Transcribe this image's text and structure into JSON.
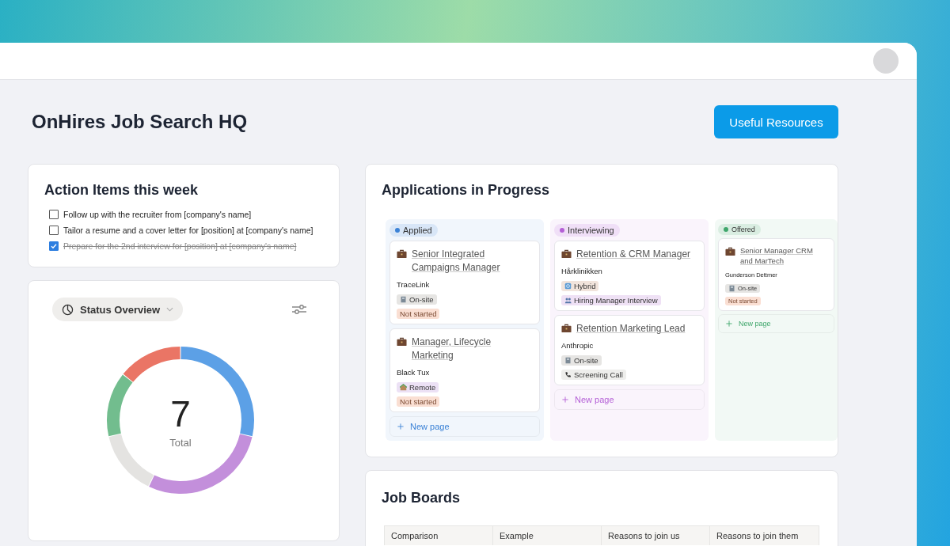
{
  "page": {
    "title": "OnHires Job Search HQ",
    "resources_button": "Useful Resources"
  },
  "action_items": {
    "title": "Action Items this week",
    "items": [
      {
        "text": "Follow up with the recruiter from [company's name]",
        "checked": false
      },
      {
        "text": "Tailor a resume and a cover letter for [position] at [company's name]",
        "checked": false
      },
      {
        "text": "Prepare for the 2nd interview for [position] at [company's name]",
        "checked": true
      }
    ]
  },
  "status_overview": {
    "view_label": "Status Overview",
    "total": "7",
    "total_label": "Total"
  },
  "applications": {
    "title": "Applications in Progress",
    "columns": [
      {
        "name": "Applied",
        "color": "#3b82d6",
        "compact": false,
        "new_page": "New page",
        "cards": [
          {
            "title": "Senior Integrated Campaigns Manager",
            "company": "TraceLink",
            "tags": [
              {
                "text": "On-site",
                "kind": "onsite",
                "color": "#e6e5e3"
              },
              {
                "text": "Not started",
                "kind": "status",
                "color": "#fadfd3"
              }
            ]
          },
          {
            "title": "Manager, Lifecycle Marketing",
            "company": "Black Tux",
            "tags": [
              {
                "text": "Remote",
                "kind": "remote",
                "color": "#ece1f5"
              },
              {
                "text": "Not started",
                "kind": "status",
                "color": "#fadfd3"
              }
            ]
          }
        ]
      },
      {
        "name": "Interviewing",
        "color": "#b45fd6",
        "compact": false,
        "new_page": "New page",
        "cards": [
          {
            "title": "Retention & CRM Manager",
            "company": "Hårklinikken",
            "tags": [
              {
                "text": "Hybrid",
                "kind": "hybrid",
                "color": "#f1e4dc"
              },
              {
                "text": "Hiring Manager Interview",
                "kind": "interview",
                "color": "#efe1f5"
              }
            ]
          },
          {
            "title": "Retention Marketing Lead",
            "company": "Anthropic",
            "tags": [
              {
                "text": "On-site",
                "kind": "onsite",
                "color": "#e6e5e3"
              },
              {
                "text": "Screening Call",
                "kind": "call",
                "color": "#eeeeec"
              }
            ]
          }
        ]
      },
      {
        "name": "Offered",
        "color": "#3fa66b",
        "compact": true,
        "new_page": "New page",
        "cards": [
          {
            "title": "Senior Manager CRM and MarTech",
            "company": "Gunderson Dettmer",
            "tags": [
              {
                "text": "On-site",
                "kind": "onsite",
                "color": "#e6e5e3"
              },
              {
                "text": "Not started",
                "kind": "status",
                "color": "#fadfd3"
              }
            ]
          }
        ]
      }
    ]
  },
  "job_boards": {
    "title": "Job Boards",
    "columns": [
      "Comparison",
      "Example",
      "Reasons to join us",
      "Reasons to join them"
    ]
  }
}
